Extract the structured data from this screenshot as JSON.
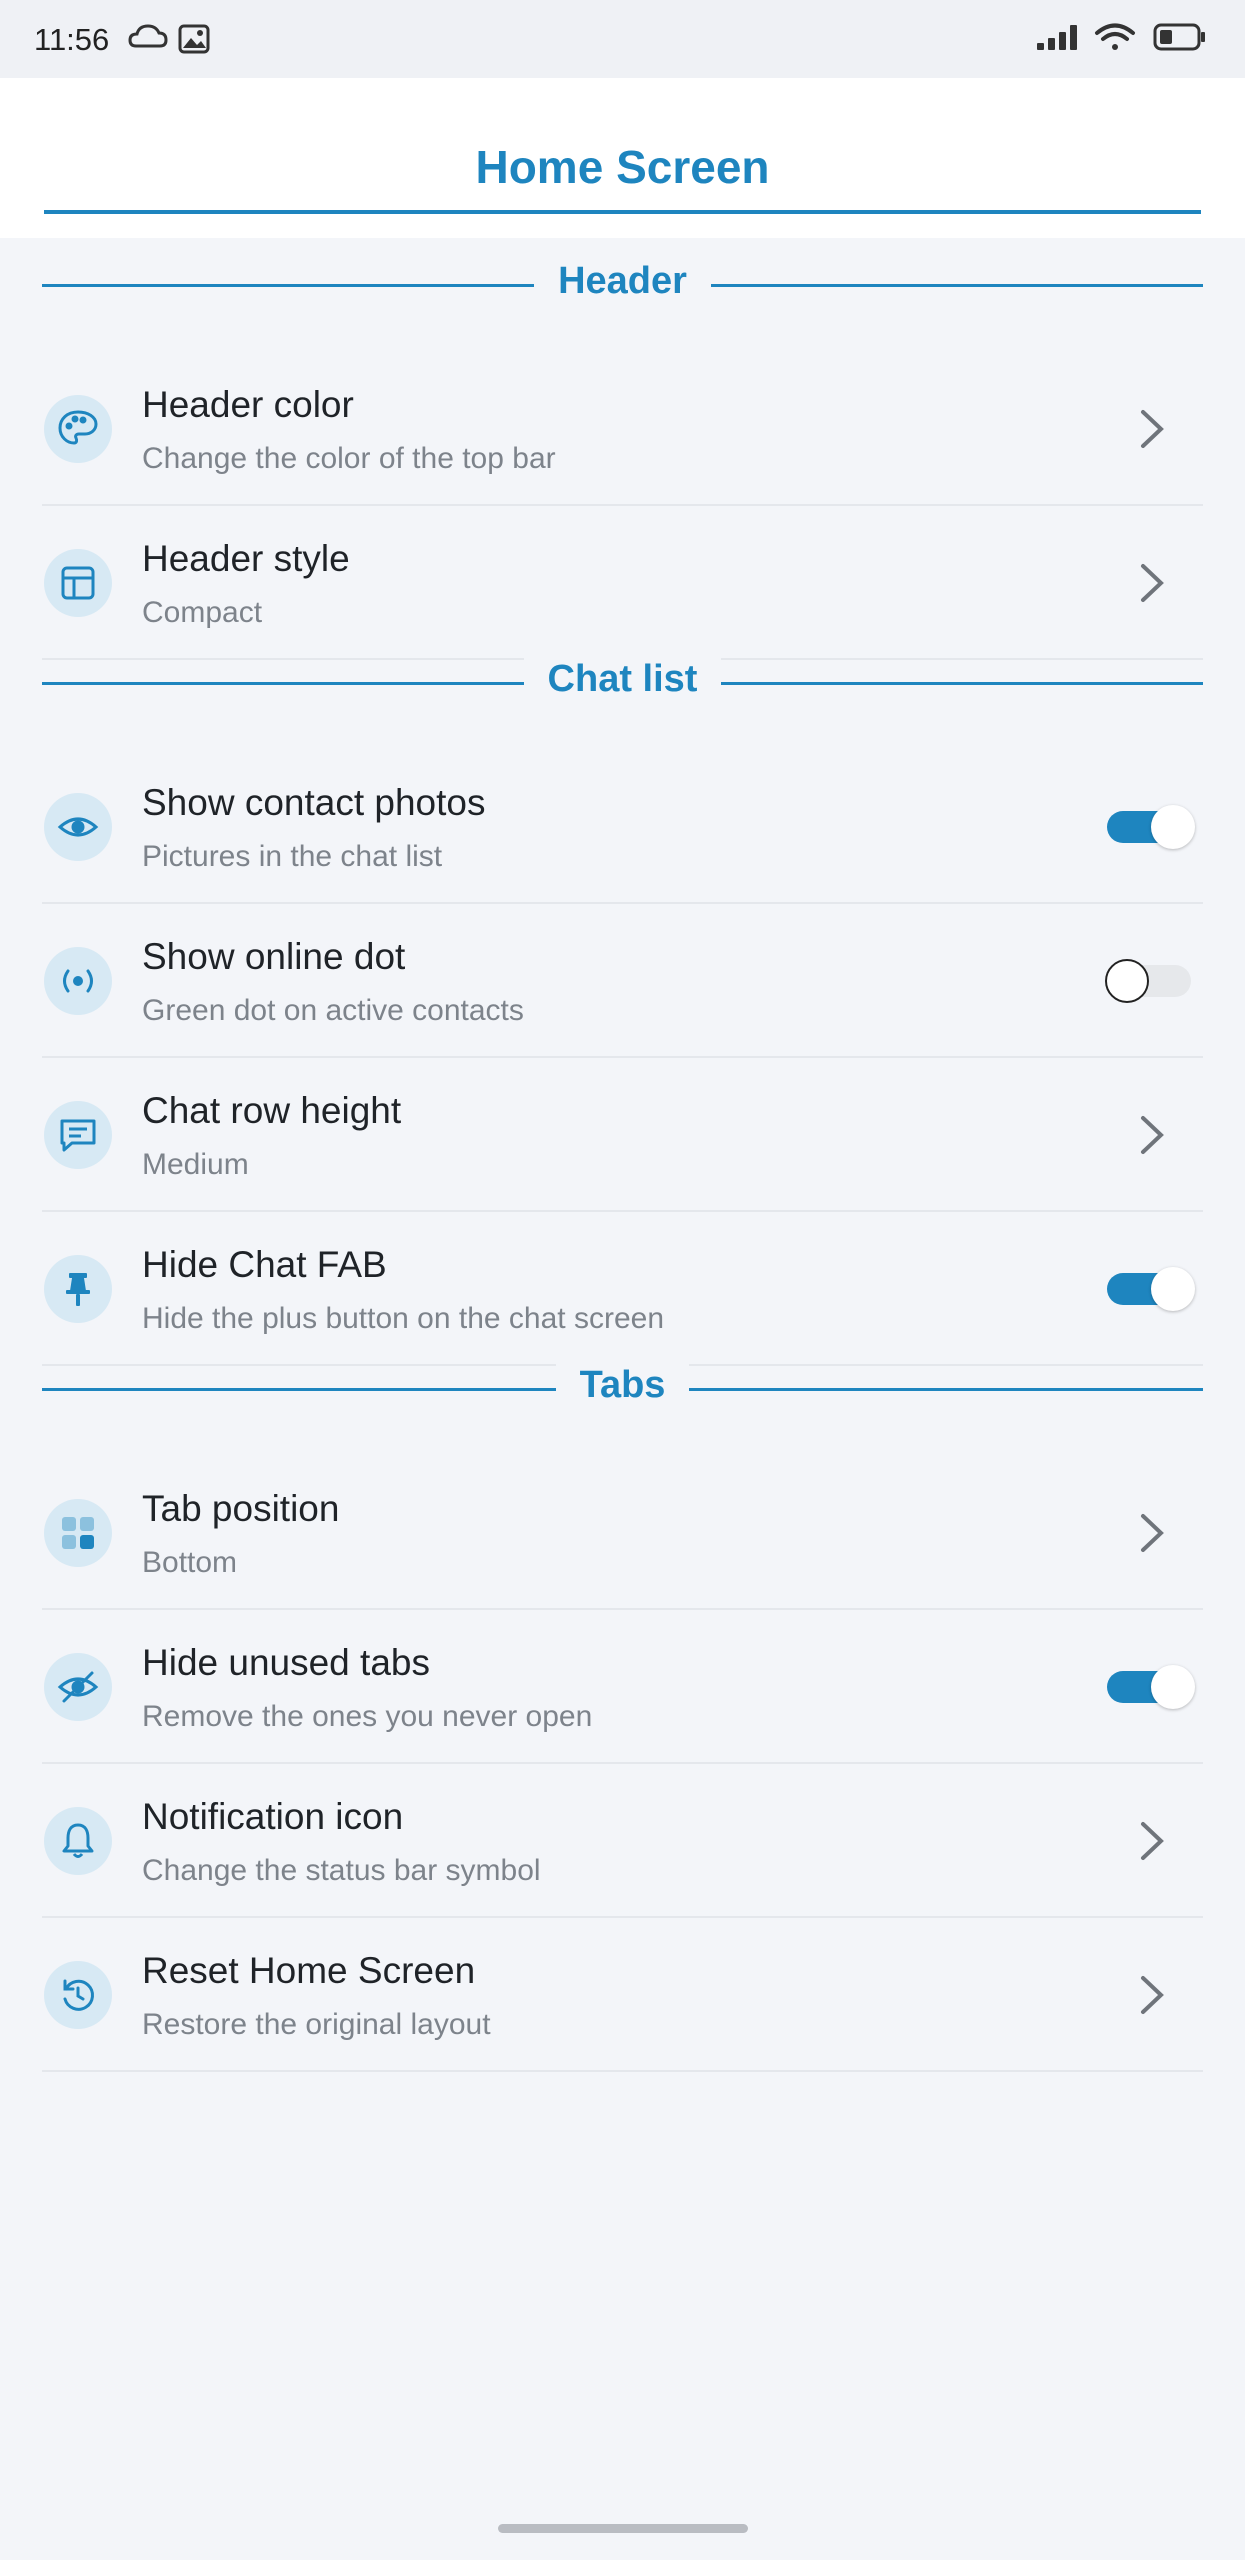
{
  "status_bar": {
    "time": "11:56",
    "left_icons": [
      "cloud-icon",
      "gallery-icon"
    ],
    "right_icons": [
      "signal-icon",
      "wifi-icon",
      "battery-icon"
    ]
  },
  "header": {
    "title": "Home Screen"
  },
  "sections": [
    {
      "title": "Header",
      "rows": [
        {
          "icon": "palette-icon",
          "title": "Header color",
          "subtitle": "Change the color of the top bar",
          "control": "chevron"
        },
        {
          "icon": "layout-icon",
          "title": "Header style",
          "subtitle": "Compact",
          "control": "chevron"
        }
      ]
    },
    {
      "title": "Chat list",
      "rows": [
        {
          "icon": "eye-icon",
          "title": "Show contact photos",
          "subtitle": "Pictures in the chat list",
          "control": "toggle",
          "checked": true
        },
        {
          "icon": "online-dot-icon",
          "title": "Show online dot",
          "subtitle": "Green dot on active contacts",
          "control": "toggle",
          "checked": false
        },
        {
          "icon": "chat-bubble-icon",
          "title": "Chat row height",
          "subtitle": "Medium",
          "control": "chevron"
        },
        {
          "icon": "pin-icon",
          "title": "Hide Chat FAB",
          "subtitle": "Hide the plus button on the chat screen",
          "control": "toggle",
          "checked": true
        }
      ]
    },
    {
      "title": "Tabs",
      "rows": [
        {
          "icon": "grid-icon",
          "title": "Tab position",
          "subtitle": "Bottom",
          "control": "chevron"
        },
        {
          "icon": "eye-off-icon",
          "title": "Hide unused tabs",
          "subtitle": "Remove the ones you never open",
          "control": "toggle",
          "checked": true
        },
        {
          "icon": "bell-icon",
          "title": "Notification icon",
          "subtitle": "Change the status bar symbol",
          "control": "chevron"
        },
        {
          "icon": "reset-icon",
          "title": "Reset Home Screen",
          "subtitle": "Restore the original layout",
          "control": "chevron"
        }
      ]
    }
  ],
  "colors": {
    "accent": "#1e85bf",
    "icon_bg": "#d7e9f4",
    "background": "#f3f5f9",
    "subtitle": "#7d838b"
  }
}
